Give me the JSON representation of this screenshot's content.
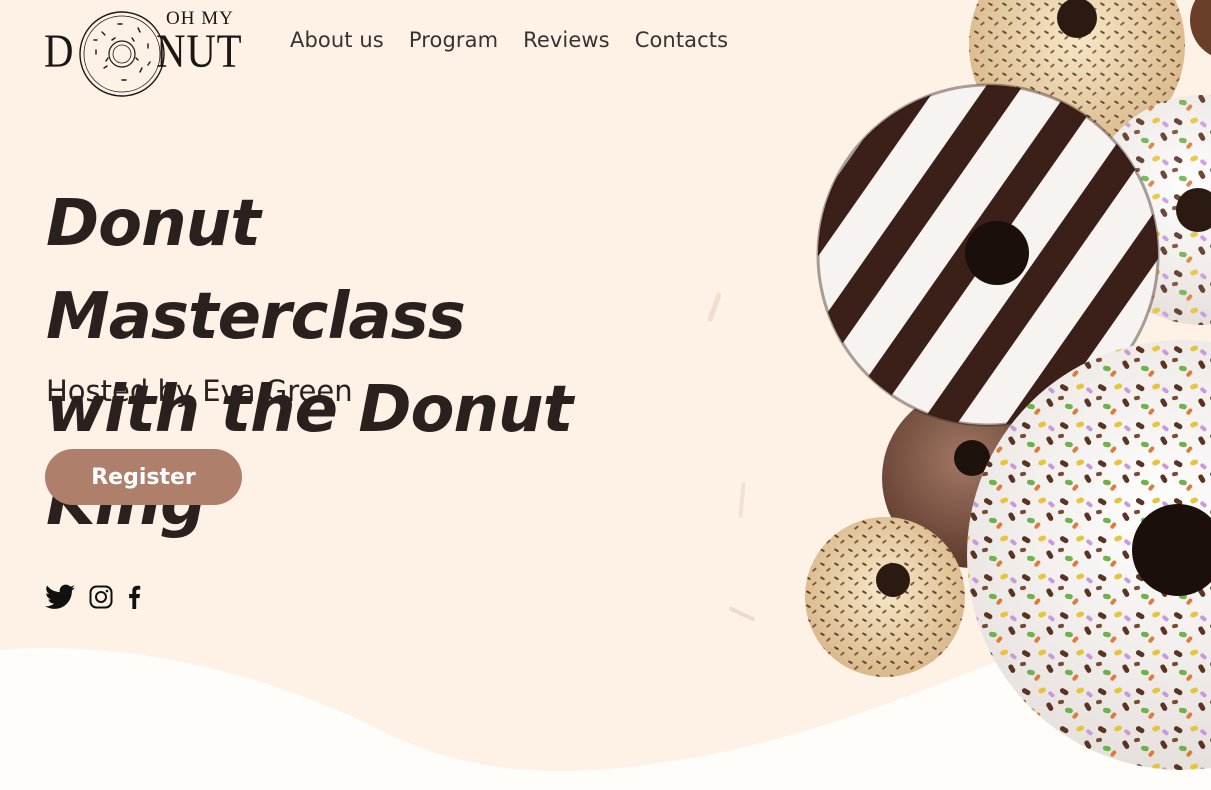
{
  "logo": {
    "top_text": "OH MY",
    "left_letter": "D",
    "right_letters": "NUT"
  },
  "nav": {
    "items": [
      {
        "label": "About us"
      },
      {
        "label": "Program"
      },
      {
        "label": "Reviews"
      },
      {
        "label": "Contacts"
      }
    ]
  },
  "hero": {
    "title_line1": "Donut Masterclass",
    "title_line2": "with the Donut King",
    "host": "Hosted by Eva Green",
    "register_label": "Register"
  },
  "social": {
    "icons": [
      "twitter-icon",
      "instagram-icon",
      "facebook-icon"
    ]
  },
  "colors": {
    "background": "#fef2e6",
    "wave": "#fffdf9",
    "button": "#ae806c",
    "text": "#2a211f"
  }
}
